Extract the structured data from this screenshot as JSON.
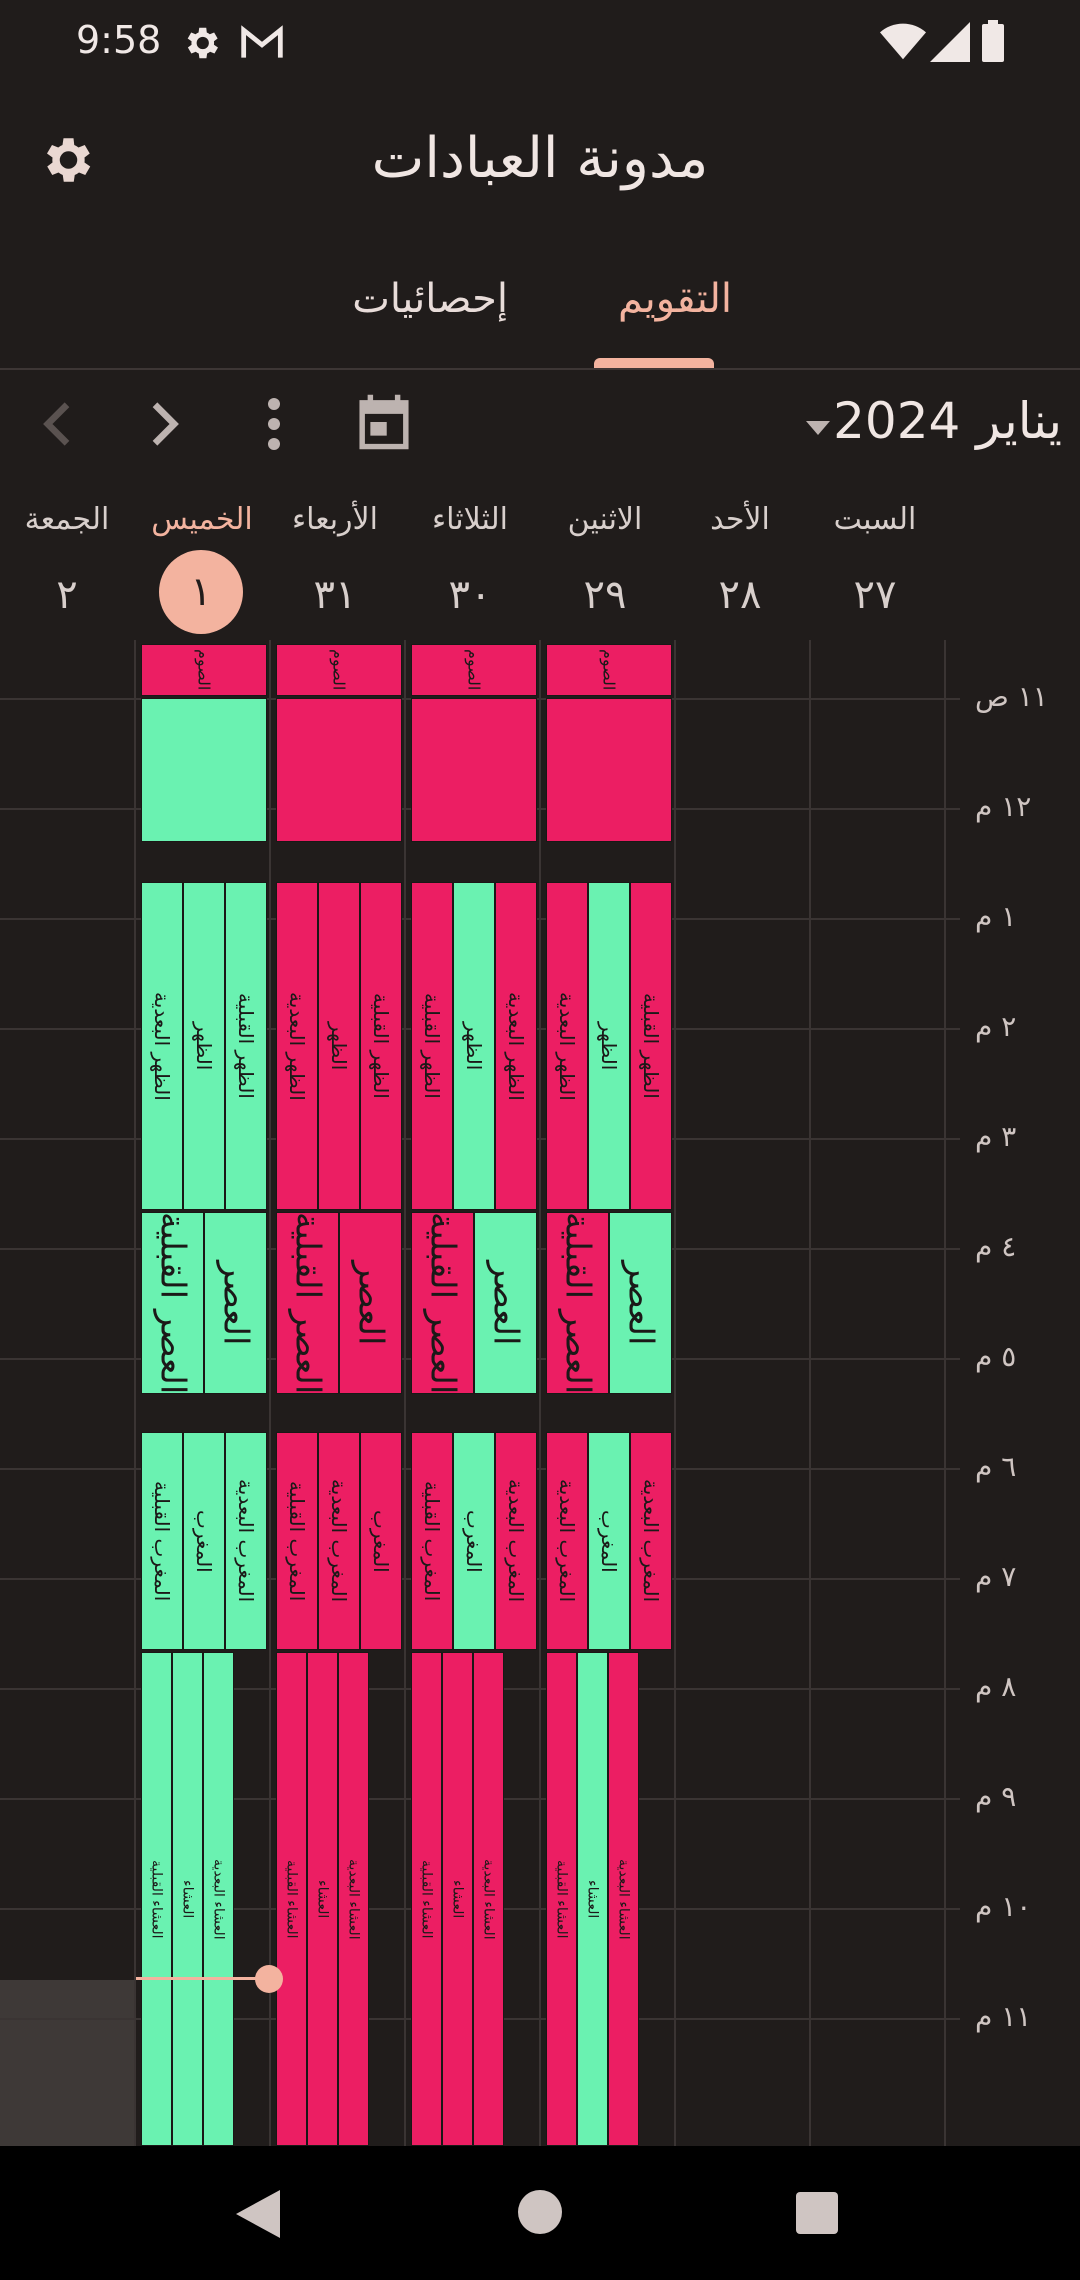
{
  "status_bar": {
    "time": "9:58"
  },
  "app_bar": {
    "title": "مدونة العبادات"
  },
  "tabs": [
    {
      "label": "التقويم",
      "selected": true
    },
    {
      "label": "إحصائيات",
      "selected": false
    }
  ],
  "toolbar": {
    "month": "يناير 2024"
  },
  "days": [
    {
      "name": "السبت",
      "num": "٢٧"
    },
    {
      "name": "الأحد",
      "num": "٢٨"
    },
    {
      "name": "الاثنين",
      "num": "٢٩"
    },
    {
      "name": "الثلاثاء",
      "num": "٣٠"
    },
    {
      "name": "الأربعاء",
      "num": "٣١"
    },
    {
      "name": "الخميس",
      "num": "١"
    },
    {
      "name": "الجمعة",
      "num": "٢"
    }
  ],
  "hours": [
    "١١ ص",
    "١٢ م",
    "١ م",
    "٢ م",
    "٣ م",
    "٤ م",
    "٥ م",
    "٦ م",
    "٧ م",
    "٨ م",
    "٩ م",
    "١٠ م",
    "١١ م"
  ],
  "labels": {
    "fast": "الصوم",
    "dhuhr_before": "الظهر القبلية",
    "dhuhr": "الظهر",
    "dhuhr_after": "الظهر البعدية",
    "asr_before": "العصر القبلية",
    "asr": "العصر",
    "maghrib_before": "المغرب القبلية",
    "maghrib": "المغرب",
    "maghrib_after": "المغرب البعدية",
    "isha_before": "العشاء القبلية",
    "isha": "العشاء",
    "isha_after": "العشاء البعدية"
  },
  "colors": {
    "done": "#6af2b1",
    "missed": "#ec1e63",
    "accent": "#f3b39f",
    "background": "#201c1b"
  },
  "icons": [
    "settings-gear-icon",
    "gmail-icon",
    "wifi-icon",
    "signal-icon",
    "battery-icon",
    "calendar-today-icon",
    "more-vert-icon",
    "chevron-right-icon",
    "chevron-left-icon",
    "dropdown-arrow-icon",
    "back-triangle-icon",
    "home-circle-icon",
    "recents-square-icon"
  ],
  "calendar": {
    "days": [
      {
        "fast": "g",
        "dhuhr": [
          [
            "dhuhr_after",
            "g"
          ],
          [
            "dhuhr",
            "g"
          ],
          [
            "dhuhr_before",
            "g"
          ]
        ],
        "asr": [
          [
            "asr_before",
            "g"
          ],
          [
            "asr",
            "g"
          ]
        ],
        "maghrib": [
          [
            "maghrib_before",
            "g"
          ],
          [
            "maghrib",
            "g"
          ],
          [
            "maghrib_after",
            "g"
          ]
        ],
        "isha": [
          [
            "isha_before",
            "g"
          ],
          [
            "isha",
            "g"
          ],
          [
            "isha_after",
            "g"
          ]
        ]
      },
      {
        "fast": "r",
        "dhuhr": [
          [
            "dhuhr_after",
            "r"
          ],
          [
            "dhuhr",
            "r"
          ],
          [
            "dhuhr_before",
            "r"
          ]
        ],
        "asr": [
          [
            "asr_before",
            "r"
          ],
          [
            "asr",
            "r"
          ]
        ],
        "maghrib": [
          [
            "maghrib_before",
            "r"
          ],
          [
            "maghrib_after",
            "r"
          ],
          [
            "maghrib",
            "r"
          ]
        ],
        "isha": [
          [
            "isha_before",
            "r"
          ],
          [
            "isha",
            "r"
          ],
          [
            "isha_after",
            "r"
          ]
        ]
      },
      {
        "fast": "r",
        "dhuhr": [
          [
            "dhuhr_before",
            "r"
          ],
          [
            "dhuhr",
            "g"
          ],
          [
            "dhuhr_after",
            "r"
          ]
        ],
        "asr": [
          [
            "asr_before",
            "r"
          ],
          [
            "asr",
            "g"
          ]
        ],
        "maghrib": [
          [
            "maghrib_before",
            "r"
          ],
          [
            "maghrib",
            "g"
          ],
          [
            "maghrib_after",
            "r"
          ]
        ],
        "isha": [
          [
            "isha_before",
            "r"
          ],
          [
            "isha",
            "r"
          ],
          [
            "isha_after",
            "r"
          ]
        ]
      },
      {
        "fast": "r",
        "dhuhr": [
          [
            "dhuhr_after",
            "r"
          ],
          [
            "dhuhr",
            "g"
          ],
          [
            "dhuhr_before",
            "r"
          ]
        ],
        "asr": [
          [
            "asr_before",
            "r"
          ],
          [
            "asr",
            "g"
          ]
        ],
        "maghrib": [
          [
            "maghrib_after",
            "r"
          ],
          [
            "maghrib",
            "g"
          ],
          [
            "maghrib_after",
            "r"
          ]
        ],
        "isha": [
          [
            "isha_before",
            "r"
          ],
          [
            "isha",
            "g"
          ],
          [
            "isha_after",
            "r"
          ]
        ]
      }
    ]
  }
}
